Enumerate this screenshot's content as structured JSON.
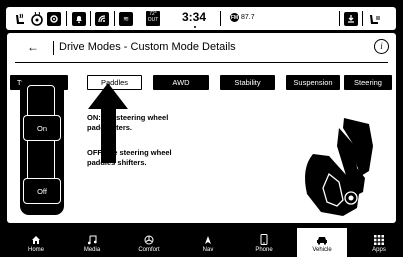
{
  "status_bar": {
    "clock": "3:34",
    "radio_badge": "FM",
    "radio_freq": "87.7",
    "outside_temp_top": "72°",
    "outside_temp_bottom": "OUT"
  },
  "header": {
    "back_glyph": "←",
    "title": "Drive Modes - Custom Mode Details",
    "info_glyph": "i"
  },
  "tabs": [
    {
      "label": "Transmission",
      "selected": false
    },
    {
      "label": "Paddles",
      "selected": true
    },
    {
      "label": "AWD",
      "selected": false
    },
    {
      "label": "Stability",
      "selected": false
    },
    {
      "label": "Suspension",
      "selected": false
    },
    {
      "label": "Steering",
      "selected": false
    }
  ],
  "paddle_switch": {
    "on_label": "On",
    "off_label": "Off"
  },
  "descriptions": {
    "on_prefix": "ON:",
    "on_text": "E     e steering wheel",
    "on_text2": "padd   hifters.",
    "off_prefix": "OFF:",
    "off_text": "ble steering wheel",
    "off_text2": "paddles shifters."
  },
  "nav": [
    {
      "label": "Home",
      "icon": "home-icon",
      "active": false
    },
    {
      "label": "Media",
      "icon": "music-note-icon",
      "active": false
    },
    {
      "label": "Comfort",
      "icon": "fan-icon",
      "active": false
    },
    {
      "label": "Nav",
      "icon": "navigation-arrow-icon",
      "active": false
    },
    {
      "label": "Phone",
      "icon": "phone-icon",
      "active": false
    },
    {
      "label": "Vehicle",
      "icon": "car-icon",
      "active": true
    },
    {
      "label": "Apps",
      "icon": "apps-grid-icon",
      "active": false
    }
  ],
  "colors": {
    "background": "#000000",
    "panel": "#ffffff",
    "text": "#000000"
  }
}
